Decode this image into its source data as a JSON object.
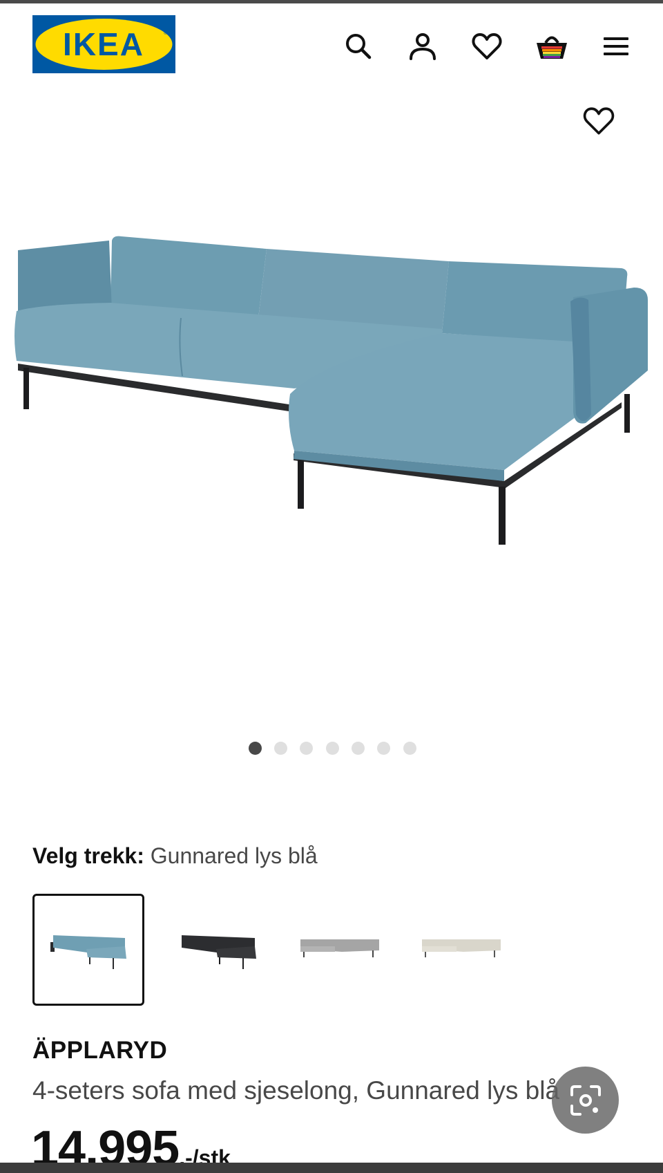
{
  "brand": {
    "logo_text": "IKEA",
    "logo_colors": {
      "background": "#0058a3",
      "ellipse": "#ffdb00",
      "text": "#0058a3"
    }
  },
  "header": {
    "icons": [
      "search-icon",
      "account-icon",
      "wishlist-icon",
      "shopping-bag-icon",
      "menu-icon"
    ]
  },
  "hero": {
    "favorite_icon": "heart-outline-icon",
    "image_subject": "sofa-with-chaise-longue-light-blue",
    "carousel": {
      "total": 7,
      "active_index": 0
    }
  },
  "variant": {
    "label": "Velg trekk:",
    "selected_value": "Gunnared lys blå",
    "options": [
      {
        "color": "#6f9fb3",
        "selected": true
      },
      {
        "color": "#2c2d30",
        "selected": false
      },
      {
        "color": "#a5a5a5",
        "selected": false
      },
      {
        "color": "#d9d6cb",
        "selected": false
      }
    ]
  },
  "product": {
    "name": "ÄPPLARYD",
    "description": "4-seters sofa med sjeselong, Gunnared lys blå",
    "price_amount": "14.995",
    "price_suffix": ",-/stk"
  },
  "overlay": {
    "lens_button_icon": "google-lens-icon"
  },
  "colors": {
    "text_primary": "#111111",
    "text_secondary": "#484848",
    "dot_active": "#484848",
    "dot_inactive": "#dfdfdf",
    "sofa_fabric": "#6f9fb3"
  }
}
